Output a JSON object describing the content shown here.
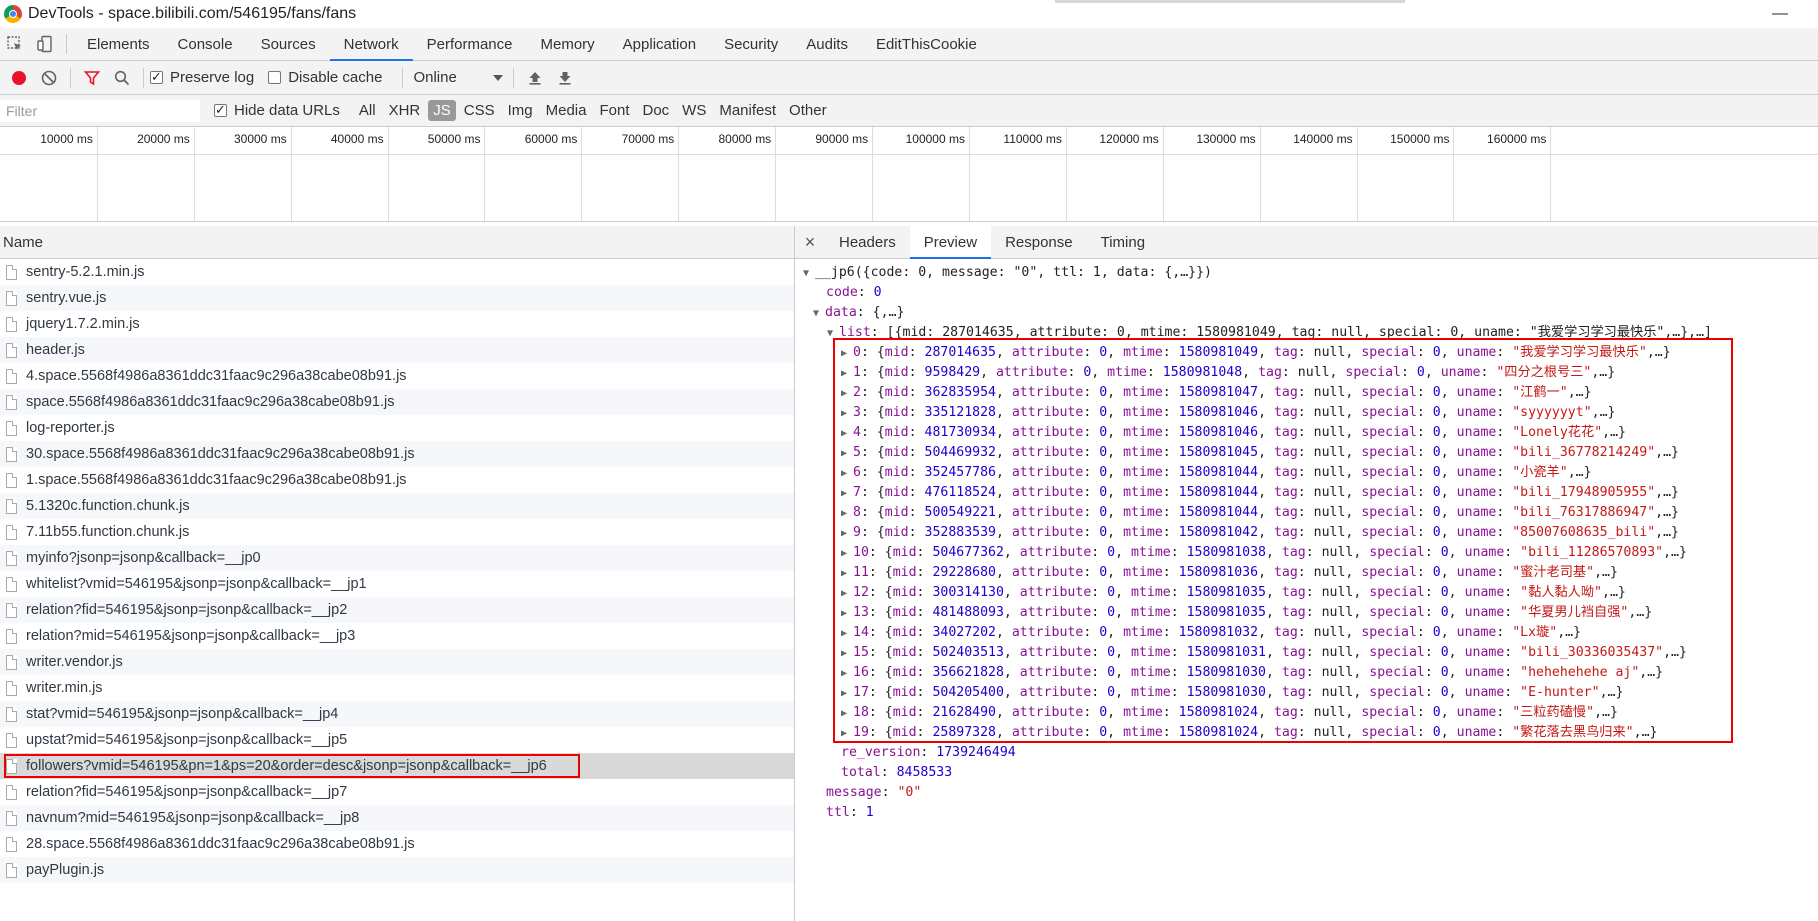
{
  "window": {
    "title": "DevTools - space.bilibili.com/546195/fans/fans",
    "minimize_glyph": "—"
  },
  "main_tabs": [
    "Elements",
    "Console",
    "Sources",
    "Network",
    "Performance",
    "Memory",
    "Application",
    "Security",
    "Audits",
    "EditThisCookie"
  ],
  "main_active_tab": "Network",
  "toolbar": {
    "preserve_log_label": "Preserve log",
    "preserve_log_checked": true,
    "disable_cache_label": "Disable cache",
    "disable_cache_checked": false,
    "throttle_value": "Online",
    "record_color": "#e8132d",
    "filter_icon_color": "#e8132d"
  },
  "filter": {
    "placeholder": "Filter",
    "hide_data_urls_label": "Hide data URLs",
    "hide_data_urls_checked": true,
    "types": [
      "All",
      "XHR",
      "JS",
      "CSS",
      "Img",
      "Media",
      "Font",
      "Doc",
      "WS",
      "Manifest",
      "Other"
    ],
    "active_type": "JS"
  },
  "timeline": {
    "ticks": [
      "10000 ms",
      "20000 ms",
      "30000 ms",
      "40000 ms",
      "50000 ms",
      "60000 ms",
      "70000 ms",
      "80000 ms",
      "90000 ms",
      "100000 ms",
      "110000 ms",
      "120000 ms",
      "130000 ms",
      "140000 ms",
      "150000 ms",
      "160000 ms"
    ]
  },
  "requests": {
    "header": "Name",
    "selected_index": 19,
    "items": [
      "sentry-5.2.1.min.js",
      "sentry.vue.js",
      "jquery1.7.2.min.js",
      "header.js",
      "4.space.5568f4986a8361ddc31faac9c296a38cabe08b91.js",
      "space.5568f4986a8361ddc31faac9c296a38cabe08b91.js",
      "log-reporter.js",
      "30.space.5568f4986a8361ddc31faac9c296a38cabe08b91.js",
      "1.space.5568f4986a8361ddc31faac9c296a38cabe08b91.js",
      "5.1320c.function.chunk.js",
      "7.11b55.function.chunk.js",
      "myinfo?jsonp=jsonp&callback=__jp0",
      "whitelist?vmid=546195&jsonp=jsonp&callback=__jp1",
      "relation?fid=546195&jsonp=jsonp&callback=__jp2",
      "relation?mid=546195&jsonp=jsonp&callback=__jp3",
      "writer.vendor.js",
      "writer.min.js",
      "stat?vmid=546195&jsonp=jsonp&callback=__jp4",
      "upstat?mid=546195&jsonp=jsonp&callback=__jp5",
      "followers?vmid=546195&pn=1&ps=20&order=desc&jsonp=jsonp&callback=__jp6",
      "relation?fid=546195&jsonp=jsonp&callback=__jp7",
      "navnum?mid=546195&jsonp=jsonp&callback=__jp8",
      "28.space.5568f4986a8361ddc31faac9c296a38cabe08b91.js",
      "payPlugin.js"
    ]
  },
  "detail": {
    "close_glyph": "×",
    "tabs": [
      "Headers",
      "Preview",
      "Response",
      "Timing"
    ],
    "active_tab": "Preview"
  },
  "preview": {
    "root": "__jp6({code: 0, message: \"0\", ttl: 1, data: {,…}})",
    "code_key": "code",
    "code_val": "0",
    "data_key": "data",
    "data_summary": "{,…}",
    "list_key": "list",
    "list_summary": "[{mid: 287014635, attribute: 0, mtime: 1580981049, tag: null, special: 0, uname: \"我爱学习学习最快乐\",…},…]",
    "list_items": [
      {
        "idx": "0",
        "mid": "287014635",
        "mtime": "1580981049",
        "uname": "我爱学习学习最快乐"
      },
      {
        "idx": "1",
        "mid": "9598429",
        "mtime": "1580981048",
        "uname": "四分之根号三"
      },
      {
        "idx": "2",
        "mid": "362835954",
        "mtime": "1580981047",
        "uname": "江鹤一"
      },
      {
        "idx": "3",
        "mid": "335121828",
        "mtime": "1580981046",
        "uname": "syyyyyyt"
      },
      {
        "idx": "4",
        "mid": "481730934",
        "mtime": "1580981046",
        "uname": "Lonely花花"
      },
      {
        "idx": "5",
        "mid": "504469932",
        "mtime": "1580981045",
        "uname": "bili_36778214249"
      },
      {
        "idx": "6",
        "mid": "352457786",
        "mtime": "1580981044",
        "uname": "小瓷羊"
      },
      {
        "idx": "7",
        "mid": "476118524",
        "mtime": "1580981044",
        "uname": "bili_17948905955"
      },
      {
        "idx": "8",
        "mid": "500549221",
        "mtime": "1580981044",
        "uname": "bili_76317886947"
      },
      {
        "idx": "9",
        "mid": "352883539",
        "mtime": "1580981042",
        "uname": "85007608635_bili"
      },
      {
        "idx": "10",
        "mid": "504677362",
        "mtime": "1580981038",
        "uname": "bili_11286570893"
      },
      {
        "idx": "11",
        "mid": "29228680",
        "mtime": "1580981036",
        "uname": "蜜汁老司基"
      },
      {
        "idx": "12",
        "mid": "300314130",
        "mtime": "1580981035",
        "uname": "黏人黏人呦"
      },
      {
        "idx": "13",
        "mid": "481488093",
        "mtime": "1580981035",
        "uname": "华夏男儿裆自强"
      },
      {
        "idx": "14",
        "mid": "34027202",
        "mtime": "1580981032",
        "uname": "Lx璇"
      },
      {
        "idx": "15",
        "mid": "502403513",
        "mtime": "1580981031",
        "uname": "bili_30336035437"
      },
      {
        "idx": "16",
        "mid": "356621828",
        "mtime": "1580981030",
        "uname": "hehehehehe aj"
      },
      {
        "idx": "17",
        "mid": "504205400",
        "mtime": "1580981030",
        "uname": "E-hunter"
      },
      {
        "idx": "18",
        "mid": "21628490",
        "mtime": "1580981024",
        "uname": "三粒药磕慢"
      },
      {
        "idx": "19",
        "mid": "25897328",
        "mtime": "1580981024",
        "uname": "繁花落去黑鸟归来"
      }
    ],
    "re_version_key": "re_version",
    "re_version_val": "1739246494",
    "total_key": "total",
    "total_val": "8458533",
    "message_key": "message",
    "message_val": "\"0\"",
    "ttl_key": "ttl",
    "ttl_val": "1"
  }
}
